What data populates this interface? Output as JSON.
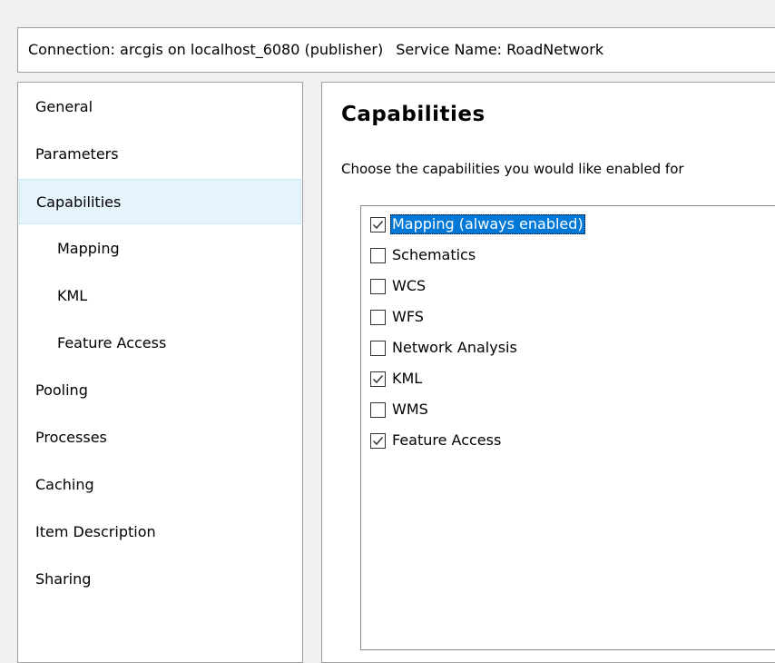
{
  "connection_bar": {
    "connection_text": "Connection: arcgis on localhost_6080 (publisher)",
    "service_text": "Service Name: RoadNetwork"
  },
  "sidebar": {
    "items": [
      {
        "label": "General",
        "sub": false,
        "selected": false
      },
      {
        "label": "Parameters",
        "sub": false,
        "selected": false
      },
      {
        "label": "Capabilities",
        "sub": false,
        "selected": true
      },
      {
        "label": "Mapping",
        "sub": true,
        "selected": false
      },
      {
        "label": "KML",
        "sub": true,
        "selected": false
      },
      {
        "label": "Feature Access",
        "sub": true,
        "selected": false
      },
      {
        "label": "Pooling",
        "sub": false,
        "selected": false
      },
      {
        "label": "Processes",
        "sub": false,
        "selected": false
      },
      {
        "label": "Caching",
        "sub": false,
        "selected": false
      },
      {
        "label": "Item Description",
        "sub": false,
        "selected": false
      },
      {
        "label": "Sharing",
        "sub": false,
        "selected": false
      }
    ]
  },
  "main": {
    "title": "Capabilities",
    "description": "Choose the capabilities you would like enabled for",
    "capabilities": [
      {
        "label": "Mapping (always enabled)",
        "checked": true,
        "selected": true
      },
      {
        "label": "Schematics",
        "checked": false,
        "selected": false
      },
      {
        "label": "WCS",
        "checked": false,
        "selected": false
      },
      {
        "label": "WFS",
        "checked": false,
        "selected": false
      },
      {
        "label": "Network Analysis",
        "checked": false,
        "selected": false
      },
      {
        "label": "KML",
        "checked": true,
        "selected": false
      },
      {
        "label": "WMS",
        "checked": false,
        "selected": false
      },
      {
        "label": "Feature Access",
        "checked": true,
        "selected": false
      }
    ]
  },
  "colors": {
    "window_bg": "#f0f0f0",
    "panel_border": "#a0a0a0",
    "nav_selected_bg": "#e5f3fb",
    "list_selected_bg": "#0078d7"
  },
  "icons": {
    "checkbox_checked": "checkmark-icon"
  }
}
